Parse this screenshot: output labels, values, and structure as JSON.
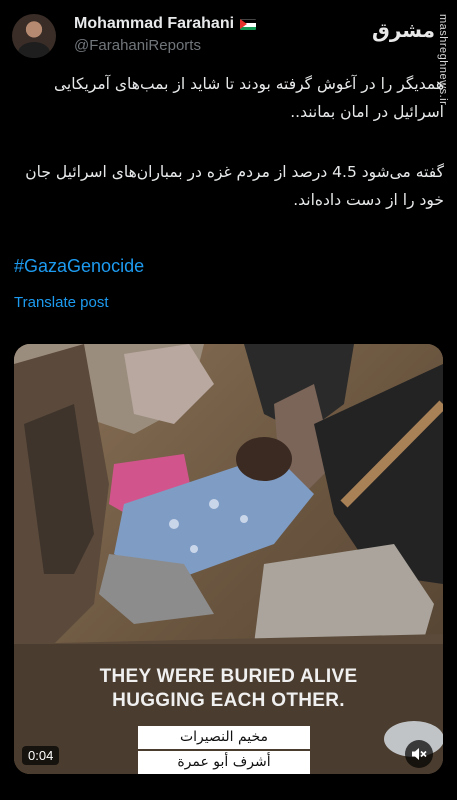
{
  "author": {
    "display_name": "Mohammad Farahani",
    "handle": "@FarahaniReports",
    "flag_icon": "palestine-flag-icon"
  },
  "watermark": {
    "logo_text": "مشرق",
    "url_text": "mashreghnews.ir"
  },
  "tweet": {
    "paragraph_1": "همدیگر را در آغوش گرفته بودند تا شاید از بمب‌های آمریکایی اسرائیل در امان بمانند..",
    "paragraph_2": "گفته می‌شود 4.5 درصد از مردم غزه در بمباران‌های اسرائیل جان خود را از دست داده‌اند.",
    "hashtag": "#GazaGenocide",
    "translate_label": "Translate post"
  },
  "media": {
    "caption_line_1": "THEY WERE BURIED ALIVE",
    "caption_line_2": "HUGGING EACH OTHER.",
    "arabic_line_1": "مخيم النصيرات",
    "arabic_line_2": "أشرف أبو عمرة",
    "timestamp": "0:04",
    "mute_icon": "muted-speaker-icon"
  },
  "colors": {
    "background": "#000000",
    "link": "#1d9bf0",
    "secondary_text": "#71767b"
  }
}
